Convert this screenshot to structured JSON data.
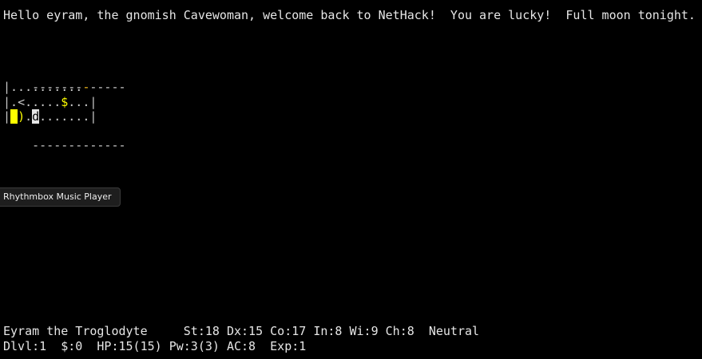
{
  "message_line": "Hello eyram, the gnomish Cavewoman, welcome back to NetHack!  You are lucky!  Full moon tonight.",
  "map": {
    "top_wall": "-------------",
    "row1": {
      "wall_left": "|",
      "floor": "..........",
      "door_right": "-"
    },
    "row2": {
      "wall_left": "|",
      "floor_a": ".",
      "upstair": "<",
      "floor_b": ".....",
      "gold": "$",
      "floor_c": "...",
      "wall_right": "|"
    },
    "row3": {
      "wall_left": "|",
      "player": "@",
      "item": ")",
      "floor_a": ".",
      "pet": "d",
      "floor_b": ".......",
      "wall_right": "|"
    },
    "bottom_wall": "-------------"
  },
  "tooltip": "Rhythmbox Music Player",
  "status": {
    "line1": "Eyram the Troglodyte     St:18 Dx:15 Co:17 In:8 Wi:9 Ch:8  Neutral",
    "line2": "Dlvl:1  $:0  HP:15(15) Pw:3(3) AC:8  Exp:1"
  },
  "colors": {
    "background": "#000000",
    "text": "#e6e6e6",
    "highlight": "#ffff00",
    "door": "#d8a000"
  }
}
